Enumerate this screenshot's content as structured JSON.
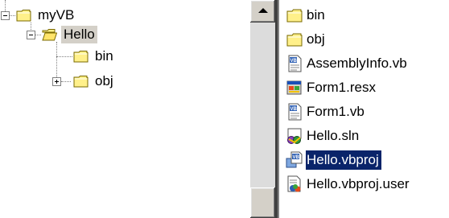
{
  "tree": {
    "nodes": [
      {
        "label": "myVB",
        "expander": "minus",
        "icon": "folder-closed-icon"
      },
      {
        "label": "Hello",
        "expander": "minus",
        "icon": "folder-open-icon",
        "selected": true
      },
      {
        "label": "bin",
        "expander": "none",
        "icon": "folder-closed-icon"
      },
      {
        "label": "obj",
        "expander": "plus",
        "icon": "folder-closed-icon"
      }
    ]
  },
  "files": [
    {
      "name": "bin",
      "icon": "folder-icon"
    },
    {
      "name": "obj",
      "icon": "folder-icon"
    },
    {
      "name": "AssemblyInfo.vb",
      "icon": "vb-file-icon"
    },
    {
      "name": "Form1.resx",
      "icon": "resx-file-icon"
    },
    {
      "name": "Form1.vb",
      "icon": "vb-file-icon"
    },
    {
      "name": "Hello.sln",
      "icon": "solution-file-icon"
    },
    {
      "name": "Hello.vbproj",
      "icon": "vb-project-icon",
      "selected": true
    },
    {
      "name": "Hello.vbproj.user",
      "icon": "project-user-file-icon"
    }
  ],
  "colors": {
    "selection_bg": "#0a246a",
    "folder_yellow": "#fff08a",
    "tree_selection_bg": "#d4d0c8"
  }
}
